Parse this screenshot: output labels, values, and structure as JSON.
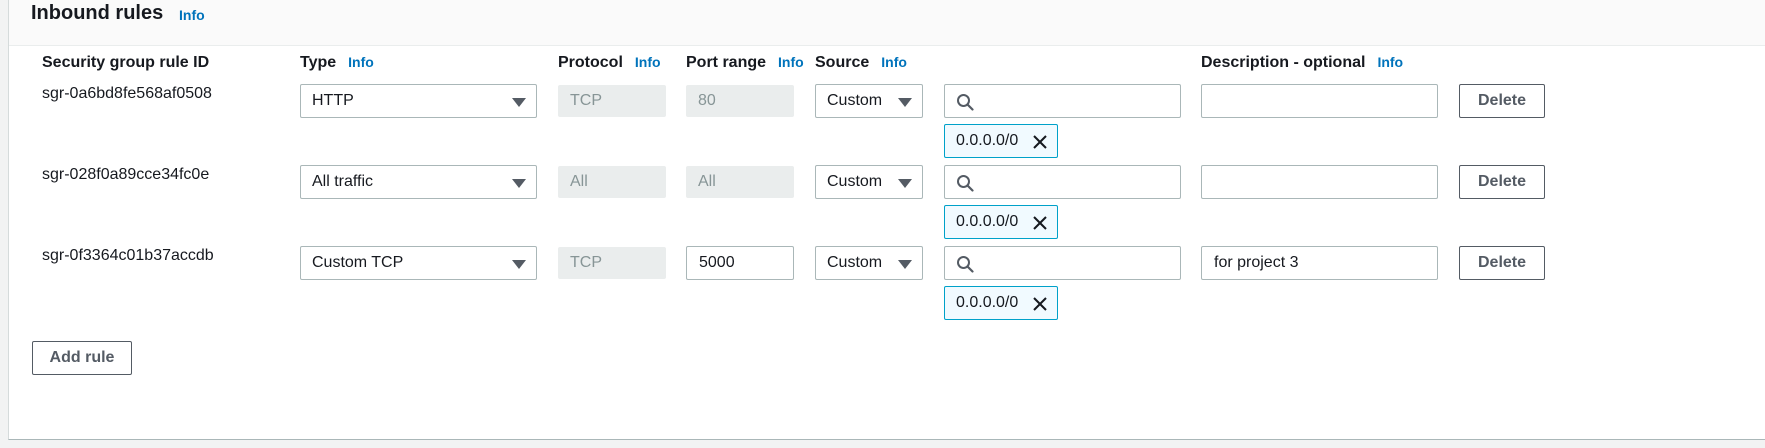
{
  "header": {
    "title": "Inbound rules",
    "info": "Info"
  },
  "columns": {
    "rule_id": "Security group rule ID",
    "type": "Type",
    "type_info": "Info",
    "protocol": "Protocol",
    "protocol_info": "Info",
    "port_range": "Port range",
    "port_range_info": "Info",
    "source": "Source",
    "source_info": "Info",
    "description": "Description - optional",
    "description_info": "Info"
  },
  "rules": [
    {
      "id": "sgr-0a6bd8fe568af0508",
      "type": "HTTP",
      "protocol": "TCP",
      "port_range": "80",
      "source": "Custom",
      "search": "",
      "cidr": "0.0.0.0/0",
      "description": "",
      "delete": "Delete"
    },
    {
      "id": "sgr-028f0a89cce34fc0e",
      "type": "All traffic",
      "protocol": "All",
      "port_range": "All",
      "source": "Custom",
      "search": "",
      "cidr": "0.0.0.0/0",
      "description": "",
      "delete": "Delete"
    },
    {
      "id": "sgr-0f3364c01b37accdb",
      "type": "Custom TCP",
      "protocol": "TCP",
      "port_range": "5000",
      "source": "Custom",
      "search": "",
      "cidr": "0.0.0.0/0",
      "description": "for project 3",
      "delete": "Delete"
    }
  ],
  "add_rule": "Add rule"
}
